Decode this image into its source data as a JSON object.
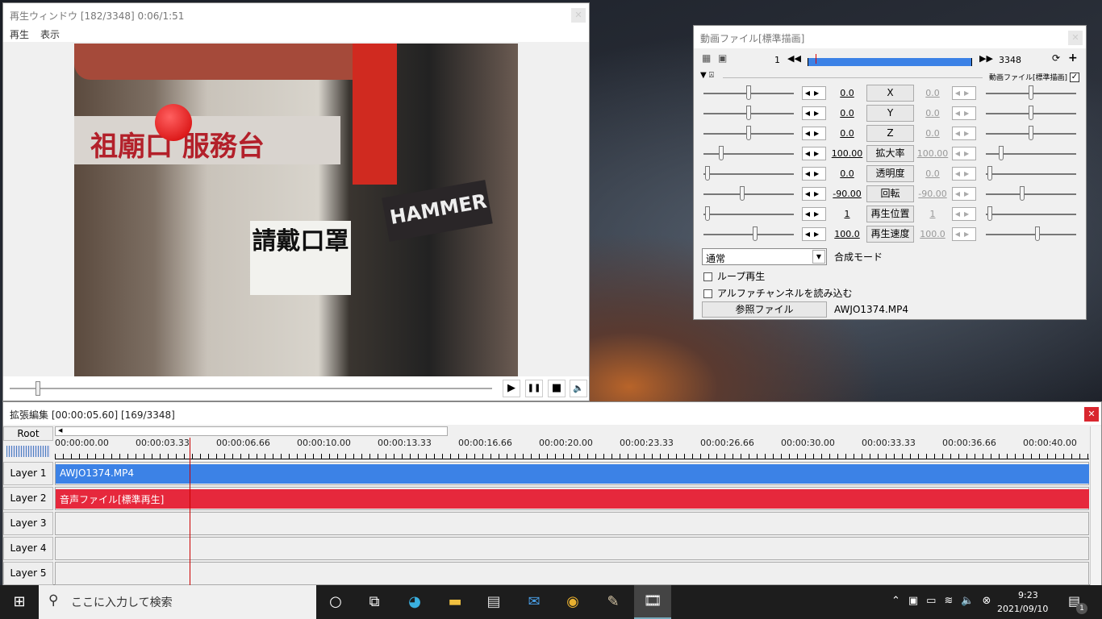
{
  "player": {
    "title": "再生ウィンドウ [182/3348]  0:06/1:51",
    "menu": [
      "再生",
      "表示"
    ],
    "video_text": {
      "sign": "祖廟口 服務台",
      "paper": "請戴口罩",
      "hammer": "HAMMER"
    },
    "controls": {
      "play": "▶",
      "pause": "❚❚",
      "stop": "■",
      "volume": "🔈"
    },
    "seek_fraction": 0.054
  },
  "props": {
    "title": "動画ファイル[標準描画]",
    "frame_start": "1",
    "frame_end": "3348",
    "section_label": "動画ファイル[標準描画]",
    "params": [
      {
        "name": "X",
        "left": "0.0",
        "right": "0.0"
      },
      {
        "name": "Y",
        "left": "0.0",
        "right": "0.0"
      },
      {
        "name": "Z",
        "left": "0.0",
        "right": "0.0"
      },
      {
        "name": "拡大率",
        "left": "100.00",
        "right": "100.00"
      },
      {
        "name": "透明度",
        "left": "0.0",
        "right": "0.0"
      },
      {
        "name": "回転",
        "left": "-90.00",
        "right": "-90.00"
      },
      {
        "name": "再生位置",
        "left": "1",
        "right": "1"
      },
      {
        "name": "再生速度",
        "left": "100.0",
        "right": "100.0"
      }
    ],
    "blend_value": "通常",
    "blend_label": "合成モード",
    "loop_label": "ループ再生",
    "alpha_label": "アルファチャンネルを読み込む",
    "ref_button": "参照ファイル",
    "ref_file": "AWJO1374.MP4"
  },
  "timeline": {
    "title": "拡張編集 [00:00:05.60] [169/3348]",
    "root": "Root",
    "ticks": [
      "00:00:00.00",
      "00:00:03.33",
      "00:00:06.66",
      "00:00:10.00",
      "00:00:13.33",
      "00:00:16.66",
      "00:00:20.00",
      "00:00:23.33",
      "00:00:26.66",
      "00:00:30.00",
      "00:00:33.33",
      "00:00:36.66",
      "00:00:40.00"
    ],
    "layers": [
      "Layer 1",
      "Layer 2",
      "Layer 3",
      "Layer 4",
      "Layer 5"
    ],
    "clips": [
      {
        "label": "AWJO1374.MP4",
        "color": "#3c82e6"
      },
      {
        "label": "音声ファイル[標準再生]",
        "color": "#e6283c"
      }
    ]
  },
  "taskbar": {
    "search_placeholder": "ここに入力して検索",
    "time": "9:23",
    "date": "2021/09/10",
    "notification_count": "1"
  }
}
